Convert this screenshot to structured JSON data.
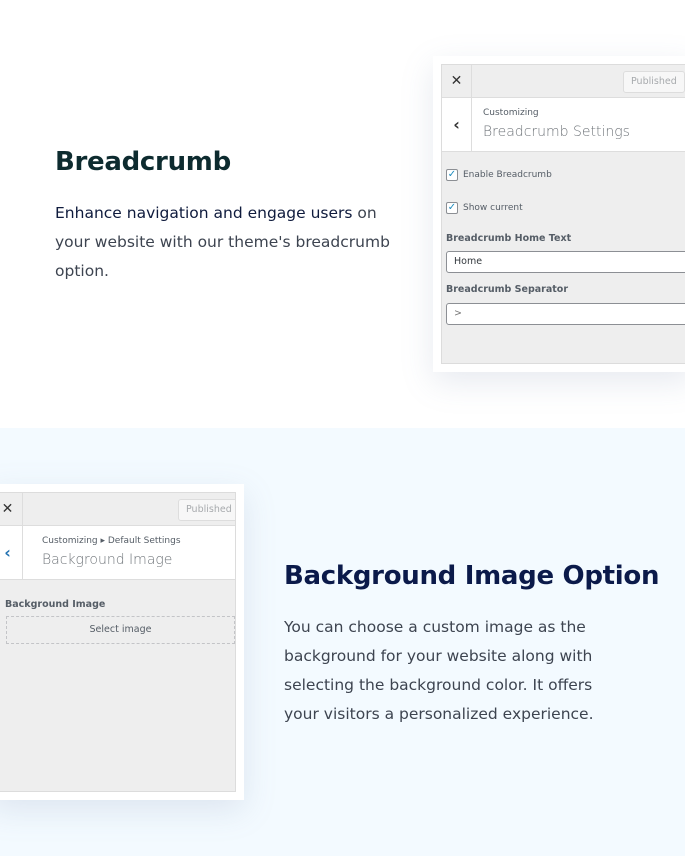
{
  "sections": {
    "breadcrumb": {
      "title": "Breadcrumb",
      "desc_highlight": "Enhance navigation and engage users",
      "desc_rest": " on your website with our theme's breadcrumb option.",
      "panel": {
        "close_icon": "close-icon",
        "publish_label": "Published",
        "back_icon": "chevron-left-icon",
        "crumb": "Customizing",
        "heading": "Breadcrumb Settings",
        "checkboxes": [
          {
            "label": "Enable Breadcrumb",
            "checked": true
          },
          {
            "label": "Show current",
            "checked": true
          }
        ],
        "fields": [
          {
            "label": "Breadcrumb Home Text",
            "value": "Home"
          },
          {
            "label": "Breadcrumb Separator",
            "value": ">"
          }
        ]
      }
    },
    "background_image": {
      "title": "Background Image Option",
      "desc": "You can choose a custom image as the background for your website along with selecting the background color. It offers your visitors a personalized experience.",
      "panel": {
        "close_icon": "close-icon",
        "publish_label": "Published",
        "back_icon": "chevron-left-icon",
        "crumb": "Customizing ▸ Default Settings",
        "heading": "Background Image",
        "field_label": "Background Image",
        "select_label": "Select image"
      }
    }
  },
  "colors": {
    "bottom_section_bg": "#f3faff",
    "checkbox_check": "#1e8cbe",
    "back_chevron_bottom": "#2271b1"
  }
}
